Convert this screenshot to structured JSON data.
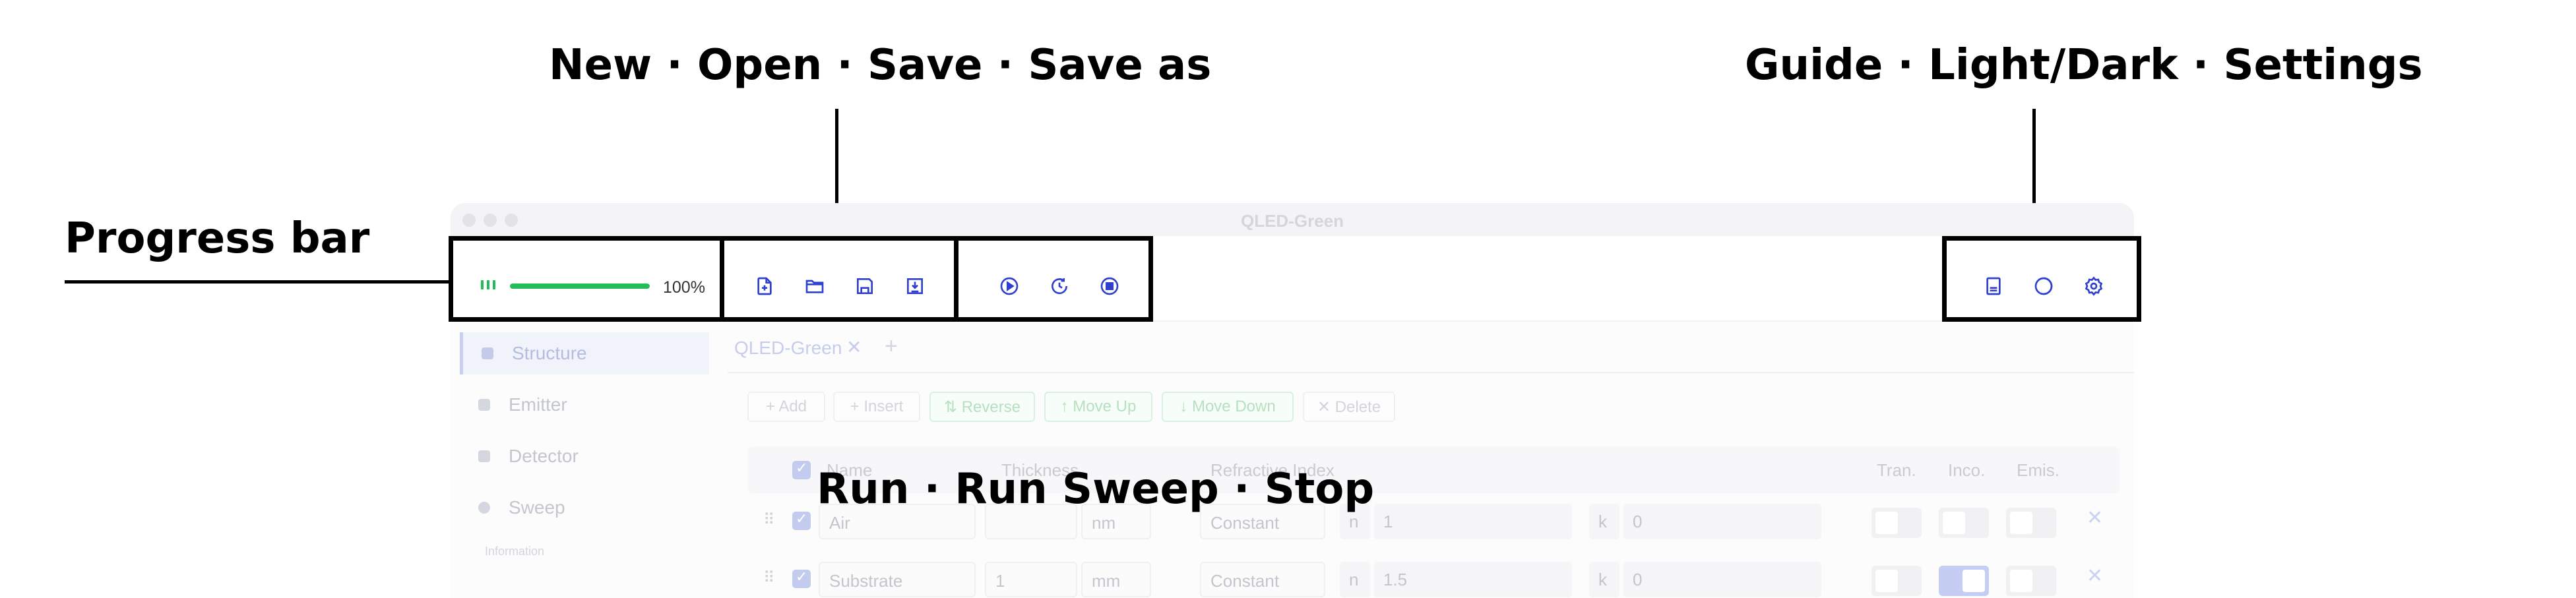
{
  "annotations": {
    "file_group": "New  ·  Open  ·  Save  ·  Save as",
    "view_group": "Guide ·  Light/Dark  ·  Settings",
    "progress": "Progress bar",
    "run_group": "Run  ·  Run Sweep ·  Stop"
  },
  "window": {
    "title": "QLED-Green"
  },
  "progress": {
    "value": 1.0,
    "label": "100%",
    "color": "#22bd58"
  },
  "toolbar": {
    "file": [
      "new-file-icon",
      "open-folder-icon",
      "save-icon",
      "save-as-icon"
    ],
    "run": [
      "run-icon",
      "run-sweep-icon",
      "stop-icon"
    ],
    "view": [
      "guide-icon",
      "light-dark-icon",
      "settings-icon"
    ],
    "accent": "#2f3fd0"
  },
  "sidebar": {
    "items": [
      {
        "label": "Structure"
      },
      {
        "label": "Emitter"
      },
      {
        "label": "Detector"
      },
      {
        "label": "Sweep"
      }
    ],
    "section": "Information"
  },
  "tabs": [
    {
      "label": "QLED-Green"
    }
  ],
  "actions": [
    "+ Add",
    "+ Insert",
    "⇅ Reverse",
    "↑ Move Up",
    "↓ Move Down",
    "✕ Delete"
  ],
  "table": {
    "headers": [
      "Name",
      "Thickness",
      "Refractive Index",
      "Tran.",
      "Inco.",
      "Emis."
    ],
    "rows": [
      {
        "name": "Air",
        "thickness": "",
        "unit": "nm",
        "model": "Constant",
        "n_label": "n",
        "n": "1",
        "k_label": "k",
        "k": "0"
      },
      {
        "name": "Substrate",
        "thickness": "1",
        "unit": "mm",
        "model": "Constant",
        "n_label": "n",
        "n": "1.5",
        "k_label": "k",
        "k": "0"
      }
    ]
  }
}
